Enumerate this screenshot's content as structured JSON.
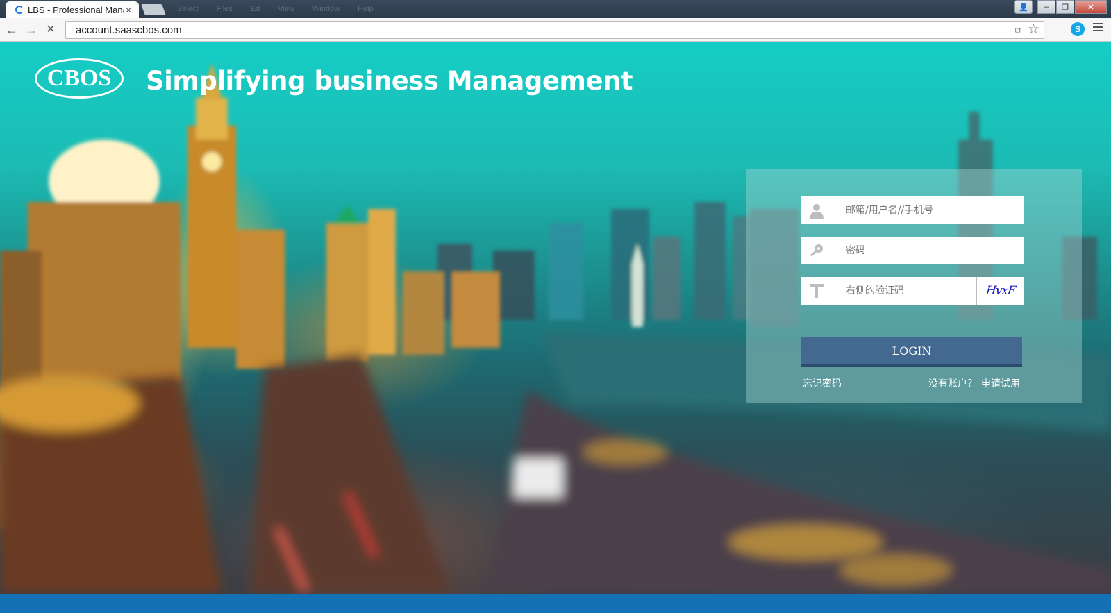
{
  "browser": {
    "tab_title": "LBS - Professional Mana",
    "tab_close": "×",
    "menu_items": [
      "Select",
      "Files",
      "Ed",
      "View",
      "Window",
      "Help"
    ],
    "window_buttons": {
      "minimize": "–",
      "maximize": "❐",
      "close": "✕",
      "user": "👤"
    },
    "back": "←",
    "forward": "→",
    "stop": "✕",
    "url": "account.saascbos.com",
    "translate_icon": "⧉",
    "bookmark_star": "☆",
    "skype_icon": "S"
  },
  "page": {
    "logo_text": "CBOS",
    "tagline": "Simplifying business Management"
  },
  "login": {
    "username_placeholder": "邮箱/用户名//手机号",
    "password_placeholder": "密码",
    "captcha_placeholder": "右侧的验证码",
    "captcha_image_text": "HvxF",
    "login_button": "LOGIN",
    "forgot_password": "忘记密码",
    "no_account": "没有账户？",
    "apply_trial": "申请试用"
  },
  "colors": {
    "panel_button": "#436990",
    "footer_bar": "#1471b4"
  }
}
